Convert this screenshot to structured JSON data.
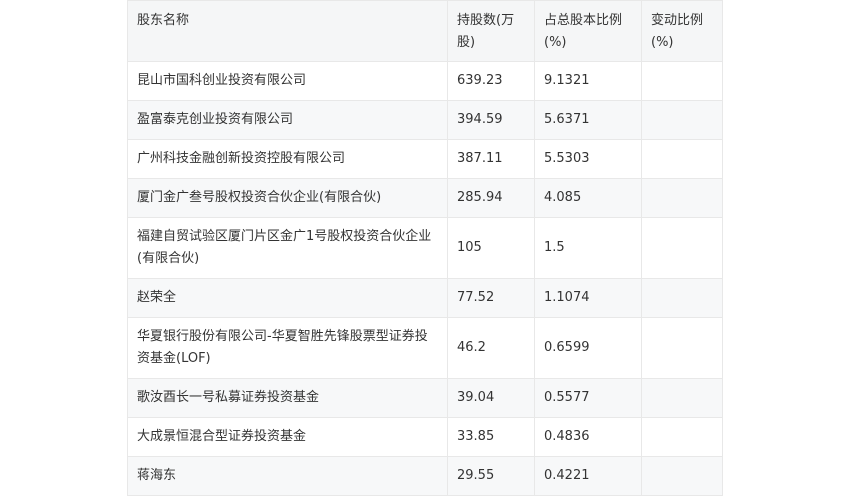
{
  "table": {
    "headers": [
      "股东名称",
      "持股数(万股)",
      "占总股本比例(%)",
      "变动比例(%)"
    ],
    "rows": [
      {
        "name": "昆山市国科创业投资有限公司",
        "shares": "639.23",
        "ratio": "9.1321",
        "change": ""
      },
      {
        "name": "盈富泰克创业投资有限公司",
        "shares": "394.59",
        "ratio": "5.6371",
        "change": ""
      },
      {
        "name": "广州科技金融创新投资控股有限公司",
        "shares": "387.11",
        "ratio": "5.5303",
        "change": ""
      },
      {
        "name": "厦门金广叁号股权投资合伙企业(有限合伙)",
        "shares": "285.94",
        "ratio": "4.085",
        "change": ""
      },
      {
        "name": "福建自贸试验区厦门片区金广1号股权投资合伙企业(有限合伙)",
        "shares": "105",
        "ratio": "1.5",
        "change": ""
      },
      {
        "name": "赵荣全",
        "shares": "77.52",
        "ratio": "1.1074",
        "change": ""
      },
      {
        "name": "华夏银行股份有限公司-华夏智胜先锋股票型证券投资基金(LOF)",
        "shares": "46.2",
        "ratio": "0.6599",
        "change": ""
      },
      {
        "name": "歌汝酉长一号私募证券投资基金",
        "shares": "39.04",
        "ratio": "0.5577",
        "change": ""
      },
      {
        "name": "大成景恒混合型证券投资基金",
        "shares": "33.85",
        "ratio": "0.4836",
        "change": ""
      },
      {
        "name": "蒋海东",
        "shares": "29.55",
        "ratio": "0.4221",
        "change": ""
      }
    ]
  }
}
